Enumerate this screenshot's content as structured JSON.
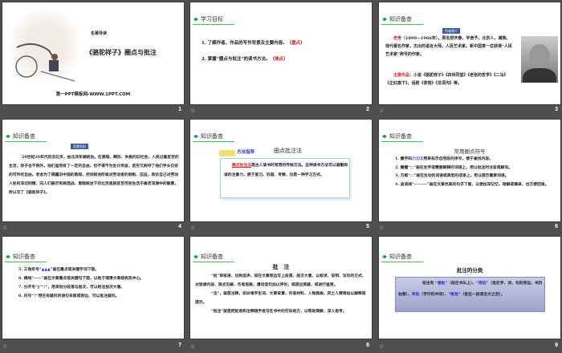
{
  "slides": [
    {
      "number": "1",
      "subtitle": "名著导读",
      "title": "《骆驼祥子》圈点与批注",
      "footer": "第一PPT模板网-WWW.1PPT.COM"
    },
    {
      "number": "2",
      "heading": "学习目标",
      "items": [
        {
          "text": "1. 了解作者、作品的写作背景及主要内容。（",
          "tag": "重点",
          "end": "）"
        },
        {
          "text": "2. 掌握“圈点与批注”的读书方法。（",
          "tag": "难点",
          "end": "）"
        }
      ]
    },
    {
      "number": "3",
      "heading": "知识备查",
      "badge": "作者简介",
      "name": "老舍",
      "p1": "（1899—1966年），原名舒庆春，字舍予，北京人，满族。现代著名作家，杰出的语言大师、人民艺术家。新中国第一位获得“人民艺术家”称号的作家。",
      "works_label": "主要作品：",
      "works": "小说《骆驼祥子》《四世同堂》《老张的哲学》《二马》《正红旗下》，话剧《茶馆》《龙须沟》等。"
    },
    {
      "number": "4",
      "heading": "知识备查",
      "badge": "背景资料",
      "p": "20世纪20年代的旧北京，由北洋军阀统治。在黑暗、畸形、失衡的旧社会，人民过着贫苦的生活，祥子也不例外。他们虽然有了一定的自由，但不得不为生计奔波，贫穷又剥夺了他们手头仅有的可怜的自由。老舍为了揭露旧中国的黑暗，控诉统治阶级对劳动者的剥削、压迫，表达自己对劳动人民的深切同情，向人们展示军阀混战、黑暗统治下的北京底层贫苦市民生活于痛苦深渊中的图景，所以写了《骆驼祥子》。"
    },
    {
      "number": "5",
      "heading": "知识备查",
      "tag": "方法指导",
      "title": "圈点批注法",
      "key": "圈点批注法",
      "p": "是古人读书时常用的传统方法。这种读书方法可以凝聚阅读的注意力，便于复习、巩固、考察，也是一种学习方式。"
    },
    {
      "number": "6",
      "heading": "知识备查",
      "title": "常用圈点符号",
      "items": [
        {
          "a": "1. 圈字码",
          "sym": "①②③",
          "b": "用来标示自然段的序号，便于查找内容。"
        },
        {
          "a": "2. 圈圈“",
          "sym": "○",
          "b": "”画在生字或需要解释的词语上，用以批注时注音或解词。"
        },
        {
          "a": "3. 方框“",
          "sym": "▭",
          "b": "”画在生动的词语或典型的成语上，用以提示重要词语。"
        },
        {
          "a": "4. 波浪线“",
          "sym": "~~~~",
          "b": "”画在文章优美的句子下面，以便加深记忆、理解或摘录，也方便回读。"
        }
      ]
    },
    {
      "number": "7",
      "heading": "知识备查",
      "items": [
        {
          "a": "5. 三角符号“",
          "sym": "▲▲▲",
          "b": "”画在重点或关键字词下面。"
        },
        {
          "a": "6. 横线“",
          "sym": "——",
          "b": "”画在文章重点或关键句下面，以助于理清文章结构及中心。"
        },
        {
          "a": "7. 分开号“",
          "sym": "‖”“/",
          "b": "”，用来划分段落与层次，可以附注层次大意。"
        },
        {
          "a": "8. 问号“",
          "sym": "?",
          "b": "”用在有疑问的语句末尾或旁边，可以批注疑问。"
        }
      ]
    },
    {
      "number": "8",
      "heading": "知识备查",
      "title": "批　注",
      "paras": [
        "“批”即批语，也称品评，如在文章旁边写上段落、层次大意，以叙述、说明、议论的方式，对思想内容、观点见解、作者思路、遣词造句加以评论，或提出质疑，或进行鉴赏。",
        "“注”，就是注释，如对难字生词、文章背景、作者材料、人物典故、风土人情等加以解释或提示。",
        "“批注”就是把批语和注释随手批写在书中的空白地方，以帮助理解，深入思考。"
      ]
    },
    {
      "number": "9",
      "heading": "知识备查",
      "title": "批注的分类",
      "segs": [
        {
          "t": "批注有 “",
          "c": ""
        },
        {
          "t": "眉批",
          "c": "blue"
        },
        {
          "t": "”（批在书头上）、“",
          "c": ""
        },
        {
          "t": "旁批",
          "c": "blue"
        },
        {
          "t": "”（批在字、词、句的旁边，书页右侧）、",
          "c": ""
        },
        {
          "t": "夹批",
          "c": "blue"
        },
        {
          "t": "（字行的中间）、“",
          "c": ""
        },
        {
          "t": "尾批",
          "c": "blue"
        },
        {
          "t": "”（批在一段或全文之后）。",
          "c": ""
        }
      ]
    }
  ],
  "colors": {
    "background": "#4f4f4f",
    "accent_green": "#1aa84a",
    "red": "#e02020",
    "blue": "#2030d0"
  },
  "icons": {
    "footer": "star-icon",
    "heading": "diamond-bullet-icon"
  }
}
